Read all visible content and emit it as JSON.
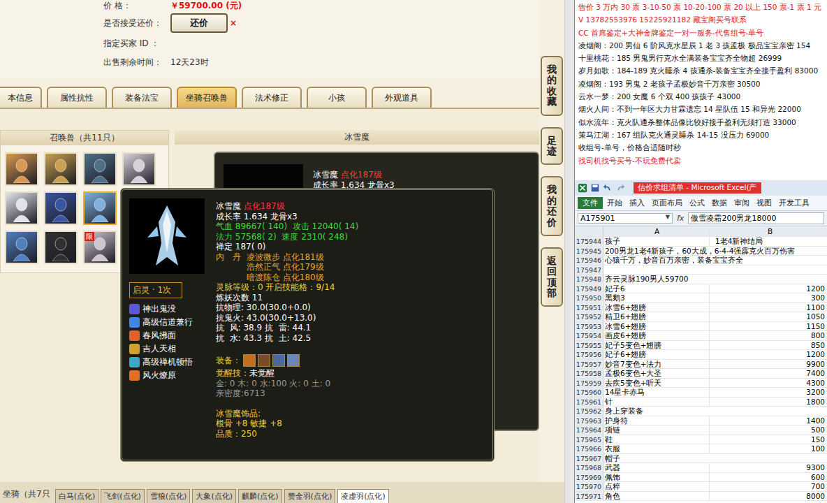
{
  "listing": {
    "price_label": "价        格：",
    "price": "￥59700.00 (元)",
    "counter_label": "是否接受还价：",
    "counter_button": "还价",
    "counter_mark": "×",
    "buyer_label": "指定买家 ID ：",
    "time_label": "出售剩余时间：",
    "time": "12天23时"
  },
  "side_buttons": [
    "我的收藏",
    "足迹",
    "我的还价",
    "返回顶部"
  ],
  "tabs": [
    {
      "label": "本信息",
      "selected": false
    },
    {
      "label": "属性抗性",
      "selected": false
    },
    {
      "label": "装备法宝",
      "selected": false
    },
    {
      "label": "坐骑召唤兽",
      "selected": true
    },
    {
      "label": "法术修正",
      "selected": false
    },
    {
      "label": "小孩",
      "selected": false
    },
    {
      "label": "外观道具",
      "selected": false
    }
  ],
  "pets_panel": {
    "title": "召唤兽（共11只）",
    "pets": [
      {
        "selected": false,
        "badge": "",
        "color": "#d89850"
      },
      {
        "selected": false,
        "badge": "",
        "color": "#c8a050"
      },
      {
        "selected": false,
        "badge": "",
        "color": "#4f6f88"
      },
      {
        "selected": false,
        "badge": "",
        "color": "#d8d0d8"
      },
      {
        "selected": false,
        "badge": "",
        "color": "#e2e2ea"
      },
      {
        "selected": false,
        "badge": "",
        "color": "#3a56a0"
      },
      {
        "selected": true,
        "badge": "",
        "color": "#7eb0e0"
      },
      {
        "selected": false,
        "badge": "",
        "color": "#d6d6e0"
      },
      {
        "selected": false,
        "badge": "",
        "color": "#5080c0"
      },
      {
        "selected": false,
        "badge": "",
        "color": "#303030"
      },
      {
        "selected": false,
        "badge": "限",
        "color": "#d0c6d0"
      }
    ]
  },
  "detail": {
    "title": "冰雪魔",
    "name": "冰雪魔",
    "grade": "点化187级",
    "growth": "成长率 1.634 龙骨x3"
  },
  "tooltip": {
    "awaken": "启灵 · 1次",
    "skills": [
      {
        "name": "神出鬼没",
        "color": "#5a5ad8"
      },
      {
        "name": "高级信道兼行",
        "color": "#3f86e0"
      },
      {
        "name": "春风拂面",
        "color": "#e0602c"
      },
      {
        "name": "吉人天相",
        "color": "#d0a030"
      },
      {
        "name": "高级禅机顿悟",
        "color": "#3aa6c8"
      },
      {
        "name": "风火燎原",
        "color": "#e07020"
      }
    ],
    "lines": [
      {
        "kind": "text",
        "segments": [
          {
            "text": "冰雪魔",
            "kind": "white"
          },
          {
            "text": " 点化187级",
            "kind": "red"
          }
        ]
      },
      {
        "kind": "text",
        "segments": [
          {
            "text": "成长率 1.634 龙骨x3",
            "kind": "white"
          }
        ]
      },
      {
        "kind": "text",
        "segments": [
          {
            "text": "气血 89667( 140)  攻击 12040( 14)",
            "kind": "green"
          }
        ]
      },
      {
        "kind": "text",
        "segments": [
          {
            "text": "法力 57568( 2)  速度 2310( 248)",
            "kind": "green"
          }
        ]
      },
      {
        "kind": "text",
        "segments": [
          {
            "text": "禅定 187( 0)",
            "kind": "white"
          }
        ]
      },
      {
        "kind": "core",
        "label": "内　丹",
        "items": [
          "凌波微步 点化181级",
          "浩然正气 点化179级",
          "暗渡陈仓 点化180级"
        ]
      },
      {
        "kind": "text",
        "segments": [
          {
            "text": "灵脉等级：0 开启技能格：9/14",
            "kind": "yellow"
          }
        ]
      },
      {
        "kind": "text",
        "segments": [
          {
            "text": "炼妖次数 11",
            "kind": "white"
          }
        ]
      },
      {
        "kind": "text",
        "segments": [
          {
            "text": "抗物理: 30.0(30.0+0.0)",
            "kind": "white"
          }
        ]
      },
      {
        "kind": "text",
        "segments": [
          {
            "text": "抗鬼火: 43.0(30.0+13.0)",
            "kind": "white"
          }
        ]
      },
      {
        "kind": "text",
        "segments": [
          {
            "text": "抗  风: 38.9 抗  雷: 44.1",
            "kind": "white"
          }
        ]
      },
      {
        "kind": "text",
        "segments": [
          {
            "text": "抗  水: 43.3 抗  土: 42.5",
            "kind": "white"
          }
        ]
      },
      {
        "kind": "blank"
      },
      {
        "kind": "equip",
        "label": "装备：",
        "items": [
          "#c07020",
          "#7a4a2a",
          "#4a6aa0",
          "#6a86b8"
        ]
      },
      {
        "kind": "text",
        "segments": [
          {
            "text": "觉醒技：",
            "kind": "yellow"
          },
          {
            "text": "未觉醒",
            "kind": "white"
          }
        ]
      },
      {
        "kind": "text",
        "segments": [
          {
            "text": "金: 0 木: 0 水:100 火: 0 土: 0",
            "kind": "grey"
          }
        ]
      },
      {
        "kind": "text",
        "segments": [
          {
            "text": "亲密度:6713",
            "kind": "grey"
          }
        ]
      },
      {
        "kind": "blank"
      },
      {
        "kind": "text",
        "segments": [
          {
            "text": "冰雪魔饰品:",
            "kind": "yellow"
          }
        ]
      },
      {
        "kind": "text",
        "segments": [
          {
            "text": "根骨 +8 敏捷 +8",
            "kind": "yellow"
          }
        ]
      },
      {
        "kind": "text",
        "segments": [
          {
            "text": "品质：250",
            "kind": "yellow"
          }
        ]
      }
    ]
  },
  "mounts": {
    "label": "坐骑（共7只",
    "tabs": [
      {
        "label": "白马(点化)",
        "selected": false
      },
      {
        "label": "飞剑(点化)",
        "selected": false
      },
      {
        "label": "雪狼(点化)",
        "selected": false
      },
      {
        "label": "大象(点化)",
        "selected": false
      },
      {
        "label": "麒麟(点化)",
        "selected": false
      },
      {
        "label": "赞金羽(点化)",
        "selected": false
      },
      {
        "label": "凌虚羽(点化)",
        "selected": true
      }
    ]
  },
  "notes": [
    {
      "text": "告价 3 万内 30 票 3-10-50 票 10-20-100 票 20 以上 150 票-1 票 1 元",
      "kind": "red"
    },
    {
      "text": "V 13782553976   15225921182  藏宝阁买号联系",
      "kind": "red"
    },
    {
      "text": "CC 首席鉴定+大神金牌鉴定一对一服务-代售组号-单号",
      "kind": "red"
    },
    {
      "text": "凌烟阁：200 男仙 6 阶风克水星辰 1 老 3 孩孟极 极品宝宝亲密 154",
      "kind": "black"
    },
    {
      "text": "十里桃花：185 男鬼男行克水全满装备宝宝齐全物超 26999",
      "kind": "black"
    },
    {
      "text": "岁月如歌：184-189 克火睡杀 4 孩通杀-装备宝宝齐全接手盈利 83000",
      "kind": "black"
    },
    {
      "text": "凌烟阁：193 男鬼 2 老孩子孟极妙音千万亲密 30500",
      "kind": "black"
    },
    {
      "text": "云水一梦：200 女魔 6 个双 400 孩孩子 43000",
      "kind": "black"
    },
    {
      "text": "烟火人间：不到一年区大力甘霖遗忘 14 星队伍 15 和异光 22000",
      "kind": "black"
    },
    {
      "text": "似水流年：克火队通杀整体品像比较好接手盈利无须打造 33000",
      "kind": "black"
    },
    {
      "text": "策马江湖：167 组队克火通灵睡杀 14-15 没压力 69000",
      "kind": "black"
    },
    {
      "text": "收组号-单号，价格合适随时秒",
      "kind": "black"
    },
    {
      "text": "找司机找号买号-不玩免费代卖",
      "kind": "red"
    }
  ],
  "excel": {
    "title": "估价求组清单 - Microsoft Excel(产",
    "ribbon": [
      {
        "label": "文件",
        "selected": true
      },
      {
        "label": "开始",
        "selected": false
      },
      {
        "label": "插入",
        "selected": false
      },
      {
        "label": "页面布局",
        "selected": false
      },
      {
        "label": "公式",
        "selected": false
      },
      {
        "label": "数据",
        "selected": false
      },
      {
        "label": "审阅",
        "selected": false
      },
      {
        "label": "视图",
        "selected": false
      },
      {
        "label": "开发工具",
        "selected": false
      }
    ],
    "name_box": "A175901",
    "name_arrow": "▼",
    "fx": "fx",
    "formula": "傲雪凌霜200男龙18000",
    "columns": [
      "A",
      "B"
    ],
    "rows": [
      {
        "num": "175944",
        "a": "孩子",
        "b": "1老4新神结局"
      },
      {
        "num": "175945",
        "a": "200男龙1老4新孩子，60大成，6-4-4强霹克火百万伤害",
        "b": ""
      },
      {
        "num": "175946",
        "a": "心猿千万，妙音百万亲密，装备宝宝齐全",
        "b": ""
      },
      {
        "num": "175947",
        "a": "",
        "b": ""
      },
      {
        "num": "175948",
        "a": "齐云灵脉190男人59700",
        "b": ""
      },
      {
        "num": "175949",
        "a": "妃子6",
        "b": "1200"
      },
      {
        "num": "175950",
        "a": "黑鹅3",
        "b": "300"
      },
      {
        "num": "175951",
        "a": "冰雪6+翅膀",
        "b": "1100"
      },
      {
        "num": "175952",
        "a": "精卫6+翅膀",
        "b": "1050"
      },
      {
        "num": "175953",
        "a": "冰雪6+翅膀",
        "b": "1150"
      },
      {
        "num": "175954",
        "a": "画皮6+翅膀",
        "b": "800"
      },
      {
        "num": "175955",
        "a": "妃子5变色+翅膀",
        "b": "850"
      },
      {
        "num": "175956",
        "a": "妃子6+翅膀",
        "b": "1200"
      },
      {
        "num": "175957",
        "a": "妙音7变色+法力",
        "b": "9900"
      },
      {
        "num": "175958",
        "a": "孟极6变色+大圣",
        "b": "7400"
      },
      {
        "num": "175959",
        "a": "去疾5变色+听天",
        "b": "4300"
      },
      {
        "num": "175960",
        "a": "14星卡赤马",
        "b": "3200"
      },
      {
        "num": "175961",
        "a": "针",
        "b": "1800"
      },
      {
        "num": "175962",
        "a": "身上穿装备",
        "b": ""
      },
      {
        "num": "175963",
        "a": "护身符",
        "b": "1400"
      },
      {
        "num": "175964",
        "a": "项链",
        "b": "500"
      },
      {
        "num": "175965",
        "a": "鞋",
        "b": "150"
      },
      {
        "num": "175966",
        "a": "衣服",
        "b": "100"
      },
      {
        "num": "175967",
        "a": "帽子",
        "b": ""
      },
      {
        "num": "175968",
        "a": "武器",
        "b": "9300"
      },
      {
        "num": "175969",
        "a": "佩饰",
        "b": "600"
      },
      {
        "num": "175970",
        "a": "点粹",
        "b": "700"
      },
      {
        "num": "175971",
        "a": "角色",
        "b": "8000"
      }
    ]
  }
}
